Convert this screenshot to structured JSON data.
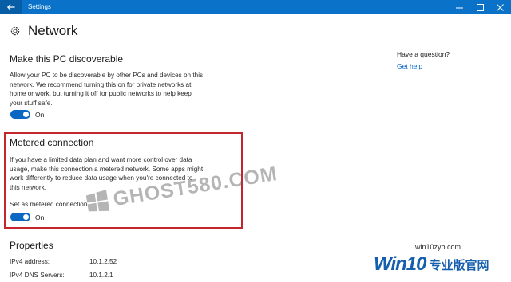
{
  "window": {
    "title": "Settings"
  },
  "page": {
    "title": "Network"
  },
  "discoverable": {
    "title": "Make this PC discoverable",
    "description": [
      "Allow your PC to be discoverable by other PCs and devices on this",
      "network. We recommend turning this on for private networks at",
      "home or work, but turning it off for public networks to help keep",
      "your stuff safe."
    ],
    "toggle_state": "On"
  },
  "metered": {
    "title": "Metered connection",
    "description": [
      "If you have a limited data plan and want more control over data",
      "usage, make this connection a metered network. Some apps might",
      "work differently to reduce data usage when you're connected to",
      "this network."
    ],
    "setting_label": "Set as metered connection",
    "toggle_state": "On"
  },
  "properties": {
    "title": "Properties",
    "rows": [
      {
        "label": "IPv4 address:",
        "value": "10.1.2.52"
      },
      {
        "label": "IPv4 DNS Servers:",
        "value": "10.1.2.1"
      }
    ]
  },
  "sidebar": {
    "question": "Have a question?",
    "link": "Get help"
  },
  "watermarks": {
    "center": "GHOST580.COM",
    "url": "win10zyb.com",
    "brand_main": "Win10",
    "brand_sub": "专业版官网"
  },
  "colors": {
    "accent": "#0a73c9",
    "highlight_border": "#c4262e",
    "toggle_on": "#0a68c3",
    "link": "#0a67c3"
  }
}
